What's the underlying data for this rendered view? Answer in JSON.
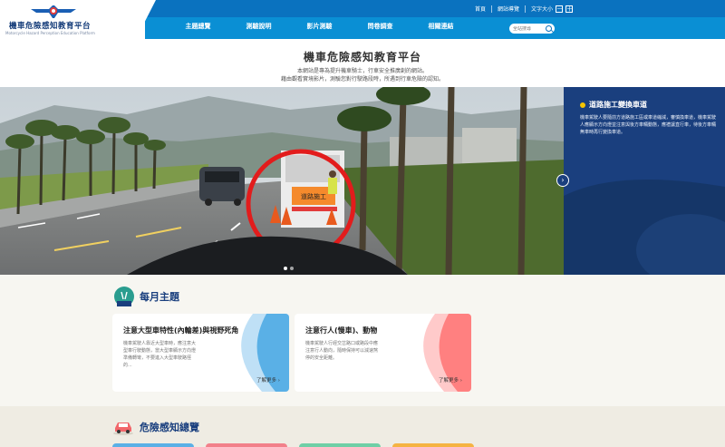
{
  "header": {
    "logo_title": "機車危險感知教育平台",
    "logo_subtitle": "Motorcycle Hazard Perception Education Platform",
    "top_links": [
      "首頁",
      "網站導覽"
    ],
    "font_size_label": "文字大小",
    "font_minus": "－",
    "font_plus": "＋",
    "nav": [
      "主題總覽",
      "測驗說明",
      "影片測驗",
      "問卷調查",
      "相關連結"
    ],
    "search_placeholder": "全站搜尋"
  },
  "intro": {
    "title": "機車危險感知教育平台",
    "line1": "本網站是專為提升機車騎士，行車安全推廣創的網站。",
    "line2": "藉由觀看實境影片，測驗您對行駛路段時，所遇到行車危險的認知。"
  },
  "hero": {
    "side_title": "道路施工變換車道",
    "side_text": "機車駕駛人要隨前方道路施工區或車道縮減，審慎換車道，機車駕駛人應顯示方向燈並注意與後方車輛動態，應禮讓直行車，待後方車輛無車時再行變換車道。",
    "next_label": "›",
    "sign_text": "道路施工",
    "slide_count": 2,
    "active_slide": 0
  },
  "monthly": {
    "title": "每月主題",
    "cards": [
      {
        "title": "注意大型車特性(內輪差)與視野死角",
        "text": "機車駕駛人靠近大型車時，應注意大型車行駛動態，當大型車顯示方向燈準備轉彎，不要進入大型車駛路徑的...",
        "more": "了解更多 ›"
      },
      {
        "title": "注意行人(慢車)、動物",
        "text": "機車駕駛人行經交岔路口或路段中應注意行人動向，隨時保持可以減速煞停的安全距離。",
        "more": "了解更多 ›"
      }
    ]
  },
  "overview": {
    "title": "危險感知總覽"
  },
  "colors": {
    "header_blue": "#0a8fd4",
    "header_dark": "#0a72bf",
    "navy": "#1a3f7e",
    "card1_accent": "#5ab0e6",
    "card2_accent": "#ff6b6b"
  }
}
